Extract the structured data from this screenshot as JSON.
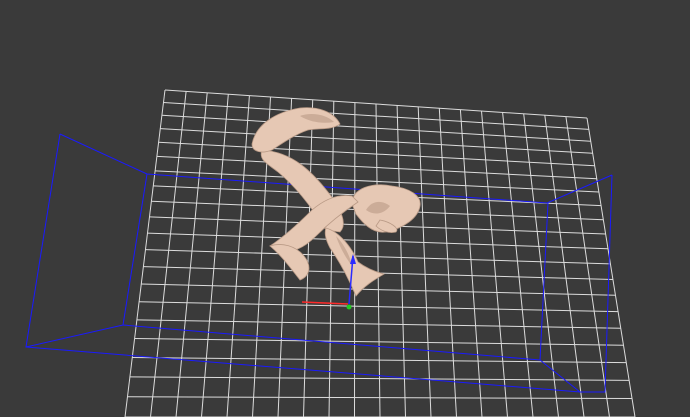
{
  "viewport": {
    "background_color": "#3a3a3a",
    "grid_color": "#dcdcdc",
    "bounding_box_color": "#1a1aff",
    "model_color": "#e6c8b4",
    "model_shadow_color": "#b99a86",
    "axis_colors": {
      "x": "#ff2a2a",
      "y": "#2a2aff",
      "z": "#22cc22"
    },
    "grid": {
      "columns": 20,
      "rows": 20
    },
    "icons": [
      "arms-hands-model",
      "transform-gizmo"
    ]
  }
}
